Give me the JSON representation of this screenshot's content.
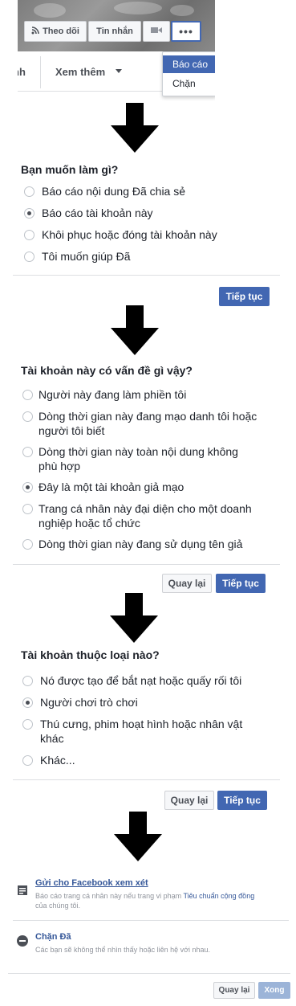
{
  "profile_header": {
    "follow_label": "Theo dõi",
    "message_label": "Tin nhắn",
    "nav_partial": "nh",
    "see_more_label": "Xem thêm",
    "dropdown": {
      "report": "Báo cáo",
      "block": "Chặn"
    }
  },
  "step1": {
    "title": "Bạn muốn làm gì?",
    "options": [
      "Báo cáo nội dung Đã chia sẻ",
      "Báo cáo tài khoản này",
      "Khôi phục hoặc đóng tài khoản này",
      "Tôi muốn giúp Đã"
    ],
    "selected_index": 1,
    "continue_label": "Tiếp tục"
  },
  "step2": {
    "title": "Tài khoản này có vấn đề gì vậy?",
    "options": [
      "Người này đang làm phiền tôi",
      [
        "Dòng thời gian này đang mạo danh tôi hoặc",
        "người tôi biết"
      ],
      [
        "Dòng thời gian này toàn nội dung không",
        "phù hợp"
      ],
      "Đây là một tài khoản giả mạo",
      [
        "Trang cá nhân này đại diện cho một doanh",
        "nghiệp hoặc tổ chức"
      ],
      "Dòng thời gian này đang sử dụng tên giả"
    ],
    "selected_index": 3,
    "back_label": "Quay lại",
    "continue_label": "Tiếp tục"
  },
  "step3": {
    "title": "Tài khoản thuộc loại nào?",
    "options": [
      "Nó được tạo để bắt nạt hoặc quấy rối tôi",
      "Người chơi trò chơi",
      [
        "Thú cưng, phim hoạt hình hoặc nhân vật",
        "khác"
      ],
      "Khác..."
    ],
    "selected_index": 1,
    "back_label": "Quay lại",
    "continue_label": "Tiếp tục"
  },
  "step4": {
    "send_title": "Gửi cho Facebook xem xét",
    "send_desc_prefix": "Báo cáo trang cá nhân này nếu trang vi phạm ",
    "send_desc_link": "Tiêu chuẩn cộng đồng",
    "send_desc_line2": "của chúng tôi.",
    "block_title": "Chặn Đã",
    "block_desc": "Các bạn sẽ không thể nhìn thấy hoặc liên hệ với nhau.",
    "back_label": "Quay lại",
    "done_label": "Xong"
  },
  "colors": {
    "primary": "#4267b2",
    "link": "#365899",
    "muted": "#90949c",
    "disabled": "#9cb4d8"
  }
}
